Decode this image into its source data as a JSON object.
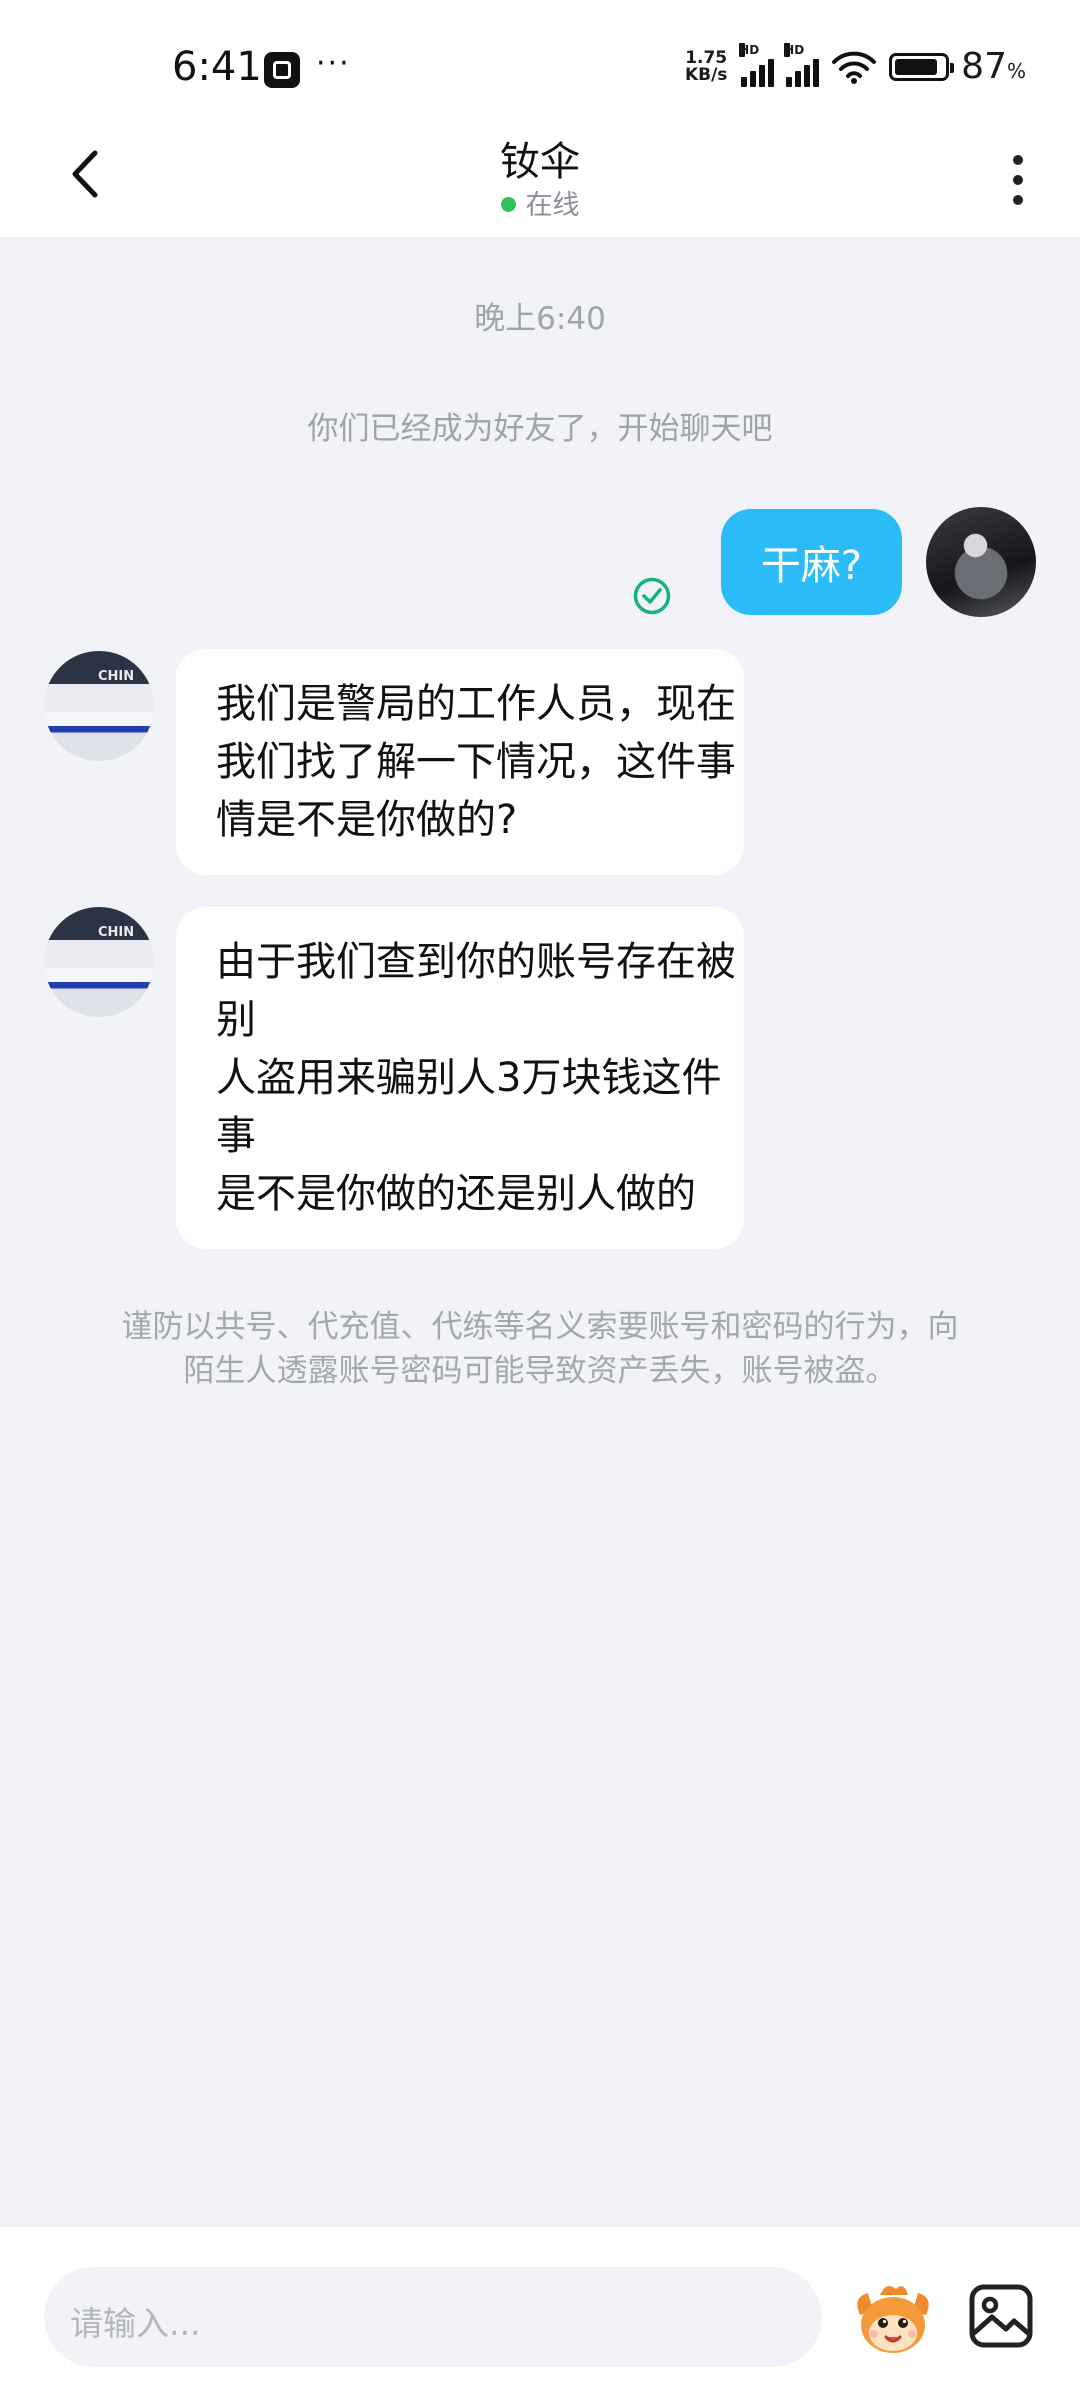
{
  "status_bar": {
    "time": "6:41",
    "more": "···",
    "speed_value": "1.75",
    "speed_unit": "KB/s",
    "hd1": "HD",
    "hd2": "HD",
    "battery_level": "87",
    "battery_unit": "%",
    "battery_fraction": 0.87
  },
  "header": {
    "title": "钕伞",
    "status": "在线"
  },
  "chat": {
    "timestamp": "晚上6:40",
    "system_note": "你们已经成为好友了，开始聊天吧",
    "outgoing": {
      "text": "干麻?"
    },
    "incoming": [
      {
        "lines": [
          "我们是警局的工作人员，现在",
          "我们找了解一下情况，这件事",
          "情是不是你做的?"
        ]
      },
      {
        "lines": [
          "由于我们查到你的账号存在被",
          "别",
          "人盗用来骗别人3万块钱这件",
          "事",
          "是不是你做的还是别人做的"
        ]
      }
    ],
    "warning_lines": [
      "谨防以共号、代充值、代练等名义索要账号和密码的行为，向",
      "陌生人透露账号密码可能导致资产丢失，账号被盗。"
    ]
  },
  "input_bar": {
    "placeholder": "请输入..."
  },
  "icons": {
    "back": "chevron-left-icon",
    "more": "more-vertical-icon",
    "read": "check-circle-icon",
    "emoji": "mascot-emoji-icon",
    "image": "image-icon"
  },
  "colors": {
    "accent": "#2bbcf7",
    "online": "#2fc25b",
    "chat_bg": "#f2f3f8"
  }
}
